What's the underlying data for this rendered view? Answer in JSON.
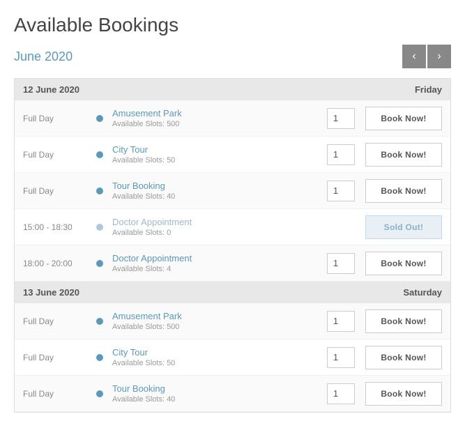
{
  "page": {
    "title": "Available Bookings",
    "month": "June 2020",
    "prev_btn": "‹",
    "next_btn": "›"
  },
  "days": [
    {
      "date": "12 June 2020",
      "day_name": "Friday",
      "bookings": [
        {
          "time": "Full Day",
          "name": "Amusement Park",
          "slots": "Available Slots: 500",
          "qty": "1",
          "action": "Book Now!",
          "sold_out": false
        },
        {
          "time": "Full Day",
          "name": "City Tour",
          "slots": "Available Slots: 50",
          "qty": "1",
          "action": "Book Now!",
          "sold_out": false
        },
        {
          "time": "Full Day",
          "name": "Tour Booking",
          "slots": "Available Slots: 40",
          "qty": "1",
          "action": "Book Now!",
          "sold_out": false
        },
        {
          "time": "15:00 - 18:30",
          "name": "Doctor Appointment",
          "slots": "Available Slots: 0",
          "qty": "",
          "action": "Sold Out!",
          "sold_out": true
        },
        {
          "time": "18:00 - 20:00",
          "name": "Doctor Appointment",
          "slots": "Available Slots: 4",
          "qty": "1",
          "action": "Book Now!",
          "sold_out": false
        }
      ]
    },
    {
      "date": "13 June 2020",
      "day_name": "Saturday",
      "bookings": [
        {
          "time": "Full Day",
          "name": "Amusement Park",
          "slots": "Available Slots: 500",
          "qty": "1",
          "action": "Book Now!",
          "sold_out": false
        },
        {
          "time": "Full Day",
          "name": "City Tour",
          "slots": "Available Slots: 50",
          "qty": "1",
          "action": "Book Now!",
          "sold_out": false
        },
        {
          "time": "Full Day",
          "name": "Tour Booking",
          "slots": "Available Slots: 40",
          "qty": "1",
          "action": "Book Now!",
          "sold_out": false
        }
      ]
    }
  ]
}
